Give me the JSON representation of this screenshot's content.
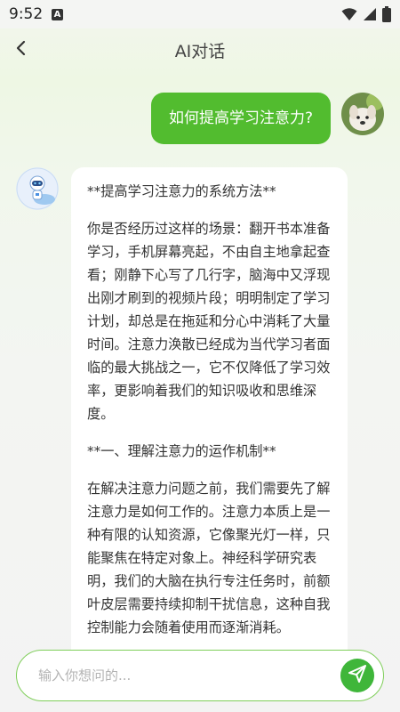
{
  "status_bar": {
    "time": "9:52",
    "notification_letter": "A",
    "icons": [
      "wifi-icon",
      "signal-icon",
      "battery-icon"
    ]
  },
  "header": {
    "back_icon": "chevron-left-icon",
    "title": "AI对话"
  },
  "conversation": {
    "user_message": "如何提高学习注意力?",
    "ai_paragraphs": [
      "**提高学习注意力的系统方法**",
      "你是否经历过这样的场景：翻开书本准备学习，手机屏幕亮起，不由自主地拿起查看；刚静下心写了几行字，脑海中又浮现出刚才刷到的视频片段；明明制定了学习计划，却总是在拖延和分心中消耗了大量时间。注意力涣散已经成为当代学习者面临的最大挑战之一，它不仅降低了学习效率，更影响着我们的知识吸收和思维深度。",
      "**一、理解注意力的运作机制**",
      "在解决注意力问题之前，我们需要先了解注意力是如何工作的。注意力本质上是一种有限的认知资源，它像聚光灯一样，只能聚焦在特定对象上。神经科学研究表明，我们的大脑在执行专注任务时，前额叶皮层需要持续抑制干扰信息，这种自我控制能力会随着使用而逐渐消耗。"
    ]
  },
  "input": {
    "placeholder": "输入你想问的...",
    "value": "",
    "send_icon": "send-icon"
  },
  "colors": {
    "accent": "#52bc2f",
    "send_button": "#3fb63a",
    "input_border": "#7fce5a"
  }
}
